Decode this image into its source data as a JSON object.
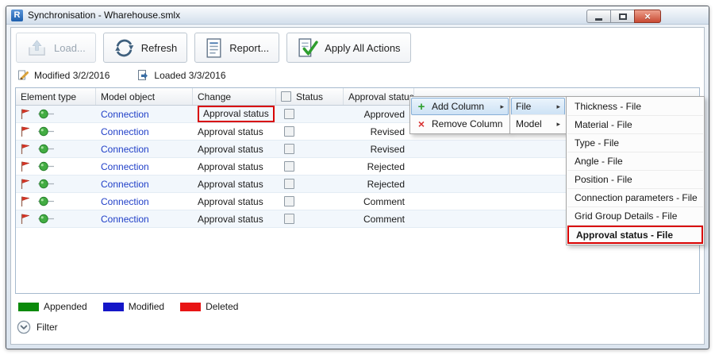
{
  "window": {
    "title": "Synchronisation - Wharehouse.smlx"
  },
  "toolbar": {
    "load_label": "Load...",
    "refresh_label": "Refresh",
    "report_label": "Report...",
    "apply_label": "Apply All Actions"
  },
  "info_bar": {
    "modified": "Modified 3/2/2016",
    "loaded": "Loaded 3/3/2016"
  },
  "table": {
    "headers": {
      "element_type": "Element type",
      "model_object": "Model object",
      "change": "Change",
      "status": "Status",
      "approval_status": "Approval status"
    },
    "rows": [
      {
        "model_object": "Connection",
        "change": "Approval status",
        "approval": "Approved"
      },
      {
        "model_object": "Connection",
        "change": "Approval status",
        "approval": "Revised"
      },
      {
        "model_object": "Connection",
        "change": "Approval status",
        "approval": "Revised"
      },
      {
        "model_object": "Connection",
        "change": "Approval status",
        "approval": "Rejected"
      },
      {
        "model_object": "Connection",
        "change": "Approval status",
        "approval": "Rejected"
      },
      {
        "model_object": "Connection",
        "change": "Approval status",
        "approval": "Comment"
      },
      {
        "model_object": "Connection",
        "change": "Approval status",
        "approval": "Comment"
      }
    ]
  },
  "context_menu": {
    "add_column": "Add Column",
    "remove_column": "Remove Column"
  },
  "source_menu": {
    "file": "File",
    "model": "Model"
  },
  "columns_menu": {
    "items": [
      {
        "label": "Thickness - File"
      },
      {
        "label": "Material - File"
      },
      {
        "label": "Type - File"
      },
      {
        "label": "Angle - File"
      },
      {
        "label": "Position - File"
      },
      {
        "label": "Connection parameters - File"
      },
      {
        "label": "Grid Group Details - File"
      },
      {
        "label": "Approval status - File"
      }
    ]
  },
  "legend": {
    "items": [
      {
        "label": "Appended",
        "color": "#0b8a0b",
        "swatch_style": "background:#0b8a0b"
      },
      {
        "label": "Modified",
        "color": "#1416c8",
        "swatch_style": "background:#1416c8"
      },
      {
        "label": "Deleted",
        "color": "#e81414",
        "swatch_style": "background:#e81414"
      }
    ]
  },
  "filter": {
    "label": "Filter"
  },
  "colors": {
    "annotation_red": "#d80000",
    "link_blue": "#2140c8",
    "menu_hover_blue": "#cde2f5",
    "close_button_red": "#c94a33"
  },
  "icons": {
    "app_logo": "R",
    "add": "+",
    "remove": "×",
    "close": "×",
    "submenu_arrow": "▸"
  }
}
